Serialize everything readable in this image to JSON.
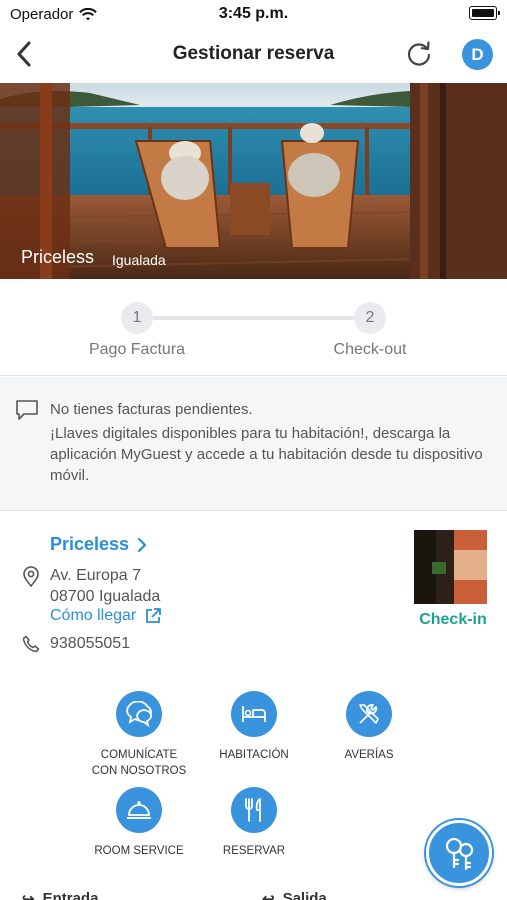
{
  "status_bar": {
    "carrier": "Operador",
    "time": "3:45 p.m."
  },
  "nav": {
    "title": "Gestionar reserva",
    "avatar_initial": "D"
  },
  "hero": {
    "hotel": "Priceless",
    "city": "Igualada"
  },
  "steps": [
    {
      "number": "1",
      "label": "Pago Factura"
    },
    {
      "number": "2",
      "label": "Check-out"
    }
  ],
  "notice": {
    "line1": "No tienes facturas pendientes.",
    "line2": "¡Llaves digitales disponibles para tu habitación!, descarga la aplicación MyGuest y accede a tu habitación desde tu dispositivo móvil."
  },
  "hotel": {
    "name": "Priceless",
    "address_line1": "Av. Europa 7",
    "address_line2": "08700 Igualada",
    "directions": "Cómo llegar",
    "phone": "938055051",
    "checkin": "Check-in"
  },
  "actions": [
    {
      "label_line1": "COMUNÍCATE",
      "label_line2": "CON NOSOTROS",
      "icon": "chat-icon"
    },
    {
      "label_line1": "HABITACIÓN",
      "label_line2": "",
      "icon": "bed-icon"
    },
    {
      "label_line1": "AVERÍAS",
      "label_line2": "",
      "icon": "tools-icon"
    },
    {
      "label_line1": "ROOM SERVICE",
      "label_line2": "",
      "icon": "cloche-icon"
    },
    {
      "label_line1": "RESERVAR",
      "label_line2": "",
      "icon": "cutlery-icon"
    }
  ],
  "bottom": {
    "entry": "Entrada",
    "exit": "Salida"
  },
  "colors": {
    "accent": "#3a93dd",
    "link": "#2a8fd8",
    "checkin": "#1aa391"
  }
}
